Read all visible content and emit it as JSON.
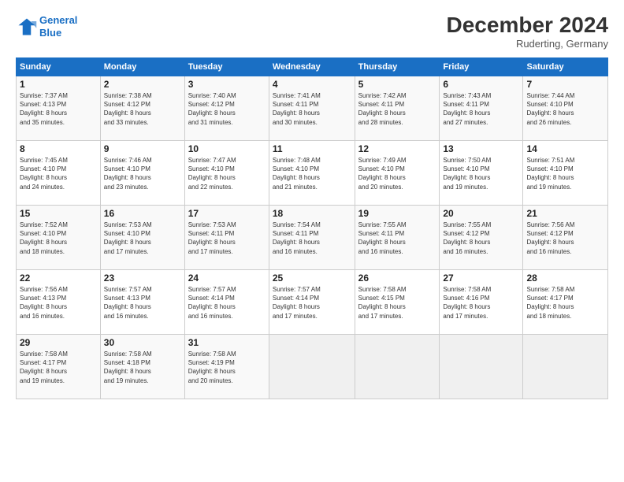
{
  "header": {
    "logo_line1": "General",
    "logo_line2": "Blue",
    "month": "December 2024",
    "location": "Ruderting, Germany"
  },
  "weekdays": [
    "Sunday",
    "Monday",
    "Tuesday",
    "Wednesday",
    "Thursday",
    "Friday",
    "Saturday"
  ],
  "weeks": [
    [
      {
        "day": "1",
        "info": "Sunrise: 7:37 AM\nSunset: 4:13 PM\nDaylight: 8 hours\nand 35 minutes."
      },
      {
        "day": "2",
        "info": "Sunrise: 7:38 AM\nSunset: 4:12 PM\nDaylight: 8 hours\nand 33 minutes."
      },
      {
        "day": "3",
        "info": "Sunrise: 7:40 AM\nSunset: 4:12 PM\nDaylight: 8 hours\nand 31 minutes."
      },
      {
        "day": "4",
        "info": "Sunrise: 7:41 AM\nSunset: 4:11 PM\nDaylight: 8 hours\nand 30 minutes."
      },
      {
        "day": "5",
        "info": "Sunrise: 7:42 AM\nSunset: 4:11 PM\nDaylight: 8 hours\nand 28 minutes."
      },
      {
        "day": "6",
        "info": "Sunrise: 7:43 AM\nSunset: 4:11 PM\nDaylight: 8 hours\nand 27 minutes."
      },
      {
        "day": "7",
        "info": "Sunrise: 7:44 AM\nSunset: 4:10 PM\nDaylight: 8 hours\nand 26 minutes."
      }
    ],
    [
      {
        "day": "8",
        "info": "Sunrise: 7:45 AM\nSunset: 4:10 PM\nDaylight: 8 hours\nand 24 minutes."
      },
      {
        "day": "9",
        "info": "Sunrise: 7:46 AM\nSunset: 4:10 PM\nDaylight: 8 hours\nand 23 minutes."
      },
      {
        "day": "10",
        "info": "Sunrise: 7:47 AM\nSunset: 4:10 PM\nDaylight: 8 hours\nand 22 minutes."
      },
      {
        "day": "11",
        "info": "Sunrise: 7:48 AM\nSunset: 4:10 PM\nDaylight: 8 hours\nand 21 minutes."
      },
      {
        "day": "12",
        "info": "Sunrise: 7:49 AM\nSunset: 4:10 PM\nDaylight: 8 hours\nand 20 minutes."
      },
      {
        "day": "13",
        "info": "Sunrise: 7:50 AM\nSunset: 4:10 PM\nDaylight: 8 hours\nand 19 minutes."
      },
      {
        "day": "14",
        "info": "Sunrise: 7:51 AM\nSunset: 4:10 PM\nDaylight: 8 hours\nand 19 minutes."
      }
    ],
    [
      {
        "day": "15",
        "info": "Sunrise: 7:52 AM\nSunset: 4:10 PM\nDaylight: 8 hours\nand 18 minutes."
      },
      {
        "day": "16",
        "info": "Sunrise: 7:53 AM\nSunset: 4:10 PM\nDaylight: 8 hours\nand 17 minutes."
      },
      {
        "day": "17",
        "info": "Sunrise: 7:53 AM\nSunset: 4:11 PM\nDaylight: 8 hours\nand 17 minutes."
      },
      {
        "day": "18",
        "info": "Sunrise: 7:54 AM\nSunset: 4:11 PM\nDaylight: 8 hours\nand 16 minutes."
      },
      {
        "day": "19",
        "info": "Sunrise: 7:55 AM\nSunset: 4:11 PM\nDaylight: 8 hours\nand 16 minutes."
      },
      {
        "day": "20",
        "info": "Sunrise: 7:55 AM\nSunset: 4:12 PM\nDaylight: 8 hours\nand 16 minutes."
      },
      {
        "day": "21",
        "info": "Sunrise: 7:56 AM\nSunset: 4:12 PM\nDaylight: 8 hours\nand 16 minutes."
      }
    ],
    [
      {
        "day": "22",
        "info": "Sunrise: 7:56 AM\nSunset: 4:13 PM\nDaylight: 8 hours\nand 16 minutes."
      },
      {
        "day": "23",
        "info": "Sunrise: 7:57 AM\nSunset: 4:13 PM\nDaylight: 8 hours\nand 16 minutes."
      },
      {
        "day": "24",
        "info": "Sunrise: 7:57 AM\nSunset: 4:14 PM\nDaylight: 8 hours\nand 16 minutes."
      },
      {
        "day": "25",
        "info": "Sunrise: 7:57 AM\nSunset: 4:14 PM\nDaylight: 8 hours\nand 17 minutes."
      },
      {
        "day": "26",
        "info": "Sunrise: 7:58 AM\nSunset: 4:15 PM\nDaylight: 8 hours\nand 17 minutes."
      },
      {
        "day": "27",
        "info": "Sunrise: 7:58 AM\nSunset: 4:16 PM\nDaylight: 8 hours\nand 17 minutes."
      },
      {
        "day": "28",
        "info": "Sunrise: 7:58 AM\nSunset: 4:17 PM\nDaylight: 8 hours\nand 18 minutes."
      }
    ],
    [
      {
        "day": "29",
        "info": "Sunrise: 7:58 AM\nSunset: 4:17 PM\nDaylight: 8 hours\nand 19 minutes."
      },
      {
        "day": "30",
        "info": "Sunrise: 7:58 AM\nSunset: 4:18 PM\nDaylight: 8 hours\nand 19 minutes."
      },
      {
        "day": "31",
        "info": "Sunrise: 7:58 AM\nSunset: 4:19 PM\nDaylight: 8 hours\nand 20 minutes."
      },
      {
        "day": "",
        "info": ""
      },
      {
        "day": "",
        "info": ""
      },
      {
        "day": "",
        "info": ""
      },
      {
        "day": "",
        "info": ""
      }
    ]
  ]
}
